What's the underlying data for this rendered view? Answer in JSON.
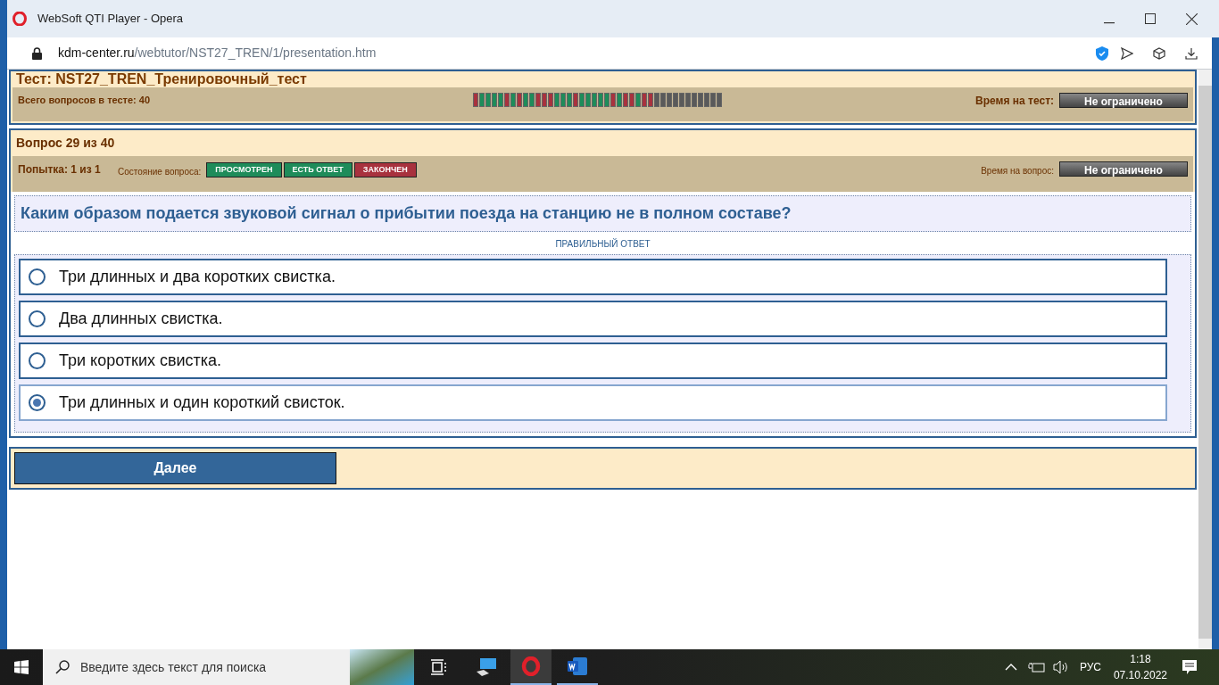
{
  "window": {
    "title": "WebSoft QTI Player - Opera"
  },
  "address_bar": {
    "host": "kdm-center.ru",
    "path": "/webtutor/NST27_TREN/1/presentation.htm"
  },
  "test_header": {
    "title": "Тест: NST27_TREN_Тренировочный_тест",
    "total_label": "Всего вопросов в тесте: 40",
    "time_label": "Время на тест:",
    "time_value": "Не ограничено",
    "progress": [
      {
        "color": "#a8323e"
      },
      {
        "color": "#1e8c5a"
      },
      {
        "color": "#1e8c5a"
      },
      {
        "color": "#1e8c5a"
      },
      {
        "color": "#1e8c5a"
      },
      {
        "color": "#a8323e"
      },
      {
        "color": "#1e8c5a"
      },
      {
        "color": "#a8323e"
      },
      {
        "color": "#1e8c5a"
      },
      {
        "color": "#1e8c5a"
      },
      {
        "color": "#a8323e"
      },
      {
        "color": "#a8323e"
      },
      {
        "color": "#a8323e"
      },
      {
        "color": "#1e8c5a"
      },
      {
        "color": "#1e8c5a"
      },
      {
        "color": "#1e8c5a"
      },
      {
        "color": "#a8323e"
      },
      {
        "color": "#1e8c5a"
      },
      {
        "color": "#1e8c5a"
      },
      {
        "color": "#1e8c5a"
      },
      {
        "color": "#1e8c5a"
      },
      {
        "color": "#1e8c5a"
      },
      {
        "color": "#a8323e"
      },
      {
        "color": "#1e8c5a"
      },
      {
        "color": "#a8323e"
      },
      {
        "color": "#a8323e"
      },
      {
        "color": "#1e8c5a"
      },
      {
        "color": "#a8323e"
      },
      {
        "color": "#a8323e"
      },
      {
        "color": "#5a5a5a"
      },
      {
        "color": "#5a5a5a"
      },
      {
        "color": "#5a5a5a"
      },
      {
        "color": "#5a5a5a"
      },
      {
        "color": "#5a5a5a"
      },
      {
        "color": "#5a5a5a"
      },
      {
        "color": "#5a5a5a"
      },
      {
        "color": "#5a5a5a"
      },
      {
        "color": "#5a5a5a"
      },
      {
        "color": "#5a5a5a"
      },
      {
        "color": "#5a5a5a"
      }
    ]
  },
  "question_header": {
    "title": "Вопрос 29 из 40",
    "attempt": "Попытка: 1 из 1",
    "state_label": "Состояние вопроса:",
    "states": [
      {
        "label": "ПРОСМОТРЕН",
        "color": "#1e8c5a"
      },
      {
        "label": "ЕСТЬ ОТВЕТ",
        "color": "#1e8c5a"
      },
      {
        "label": "ЗАКОНЧЕН",
        "color": "#a8323e"
      }
    ],
    "time_label": "Время на вопрос:",
    "time_value": "Не ограничено"
  },
  "question": {
    "text": "Каким образом подается звуковой сигнал о прибытии поезда на станцию не в полном составе?",
    "answer_caption": "ПРАВИЛЬНЫЙ ОТВЕТ",
    "options": [
      {
        "label": "Три длинных и два коротких свистка.",
        "selected": false
      },
      {
        "label": "Два длинных свистка.",
        "selected": false
      },
      {
        "label": "Три коротких свистка.",
        "selected": false
      },
      {
        "label": "Три длинных и один короткий свисток.",
        "selected": true
      }
    ]
  },
  "next_button": "Далее",
  "taskbar": {
    "search_placeholder": "Введите здесь текст для поиска",
    "language": "РУС",
    "time": "1:18",
    "date": "07.10.2022"
  }
}
